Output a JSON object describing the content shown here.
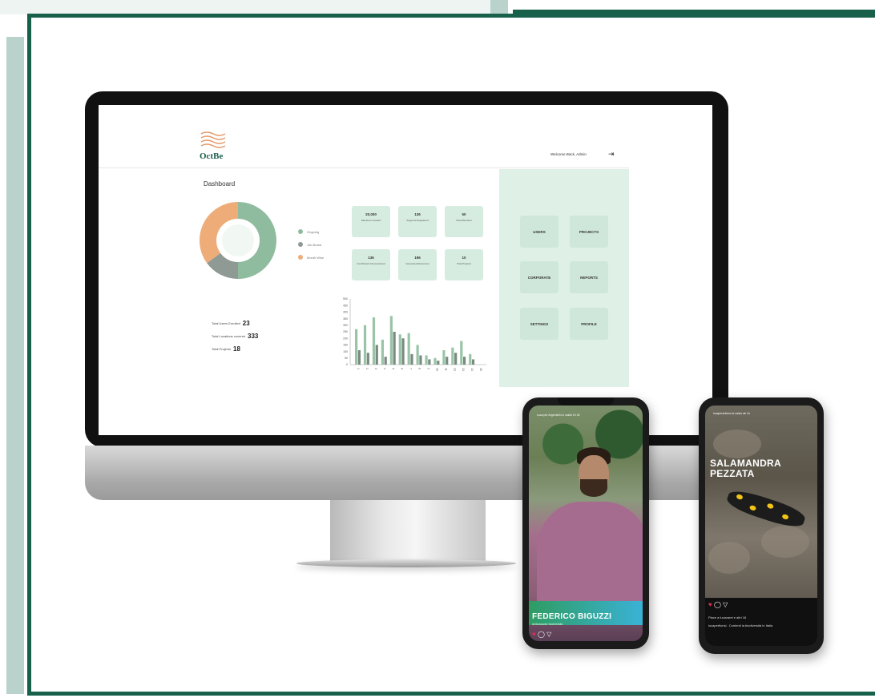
{
  "brand": {
    "logo_text": "OctBe"
  },
  "header": {
    "welcome": "Welcome Back, Admin"
  },
  "dashboard": {
    "title": "Dashboard",
    "legend": [
      {
        "label": "Ongoing",
        "color": "#8fbc9e"
      },
      {
        "label": "Job Board",
        "color": "#8e9a93"
      },
      {
        "label": "Month Wise",
        "color": "#eeac79"
      }
    ],
    "donut_segments": [
      {
        "label": "Ongoing",
        "percent": 50,
        "color": "#8fbc9e"
      },
      {
        "label": "Job Board",
        "percent": 15,
        "color": "#8e9a93"
      },
      {
        "label": "Month Wise",
        "percent": 35,
        "color": "#eeac79"
      }
    ],
    "stats": [
      {
        "value": "20,000",
        "label": "Members Created"
      },
      {
        "value": "136",
        "label": "Supports Registered"
      },
      {
        "value": "50",
        "label": "Total Members"
      },
      {
        "value": "136",
        "label": "Contributors Docs Entered"
      },
      {
        "value": "196",
        "label": "Generated Resources"
      },
      {
        "value": "10",
        "label": "Total Projects"
      }
    ],
    "totals": [
      {
        "label": "Total Users Enrolled",
        "value": "23"
      },
      {
        "label": "Total Locations covered",
        "value": "333"
      },
      {
        "label": "Total Projects",
        "value": "18"
      }
    ],
    "actions": [
      {
        "label": "USERS"
      },
      {
        "label": "PROJECTS"
      },
      {
        "label": "CORPORATE"
      },
      {
        "label": "REPORTS"
      },
      {
        "label": "SETTINGS"
      },
      {
        "label": "PROFILE"
      }
    ]
  },
  "chart_data": {
    "type": "bar",
    "ylim": [
      0,
      500
    ],
    "y_ticks": [
      "500",
      "450",
      "400",
      "350",
      "300",
      "250",
      "200",
      "150",
      "100",
      "50",
      "0"
    ],
    "categories": [
      "1",
      "2",
      "3",
      "4",
      "5",
      "6",
      "7",
      "8",
      "9",
      "10",
      "11",
      "12",
      "13",
      "14",
      "15"
    ],
    "series": [
      {
        "values": [
          270,
          300,
          360,
          190,
          370,
          230,
          240,
          150,
          70,
          50,
          110,
          130,
          180,
          80,
          0
        ]
      },
      {
        "values": [
          110,
          90,
          150,
          60,
          250,
          200,
          80,
          70,
          40,
          30,
          60,
          90,
          60,
          40,
          0
        ]
      }
    ],
    "colors": [
      "#9ac4a6",
      "#7a8a80"
    ]
  },
  "phone1": {
    "top_text": "Luca per ArgentioSi ci calciti 2h 18",
    "name": "FEDERICO BIGUZZI",
    "subtitle": "Ambassador biodiversità"
  },
  "phone2": {
    "top_text": "lucaperarfionsi si calcio ab 1h",
    "title_line1": "SALAMANDRA",
    "title_line2": "PEZZATA",
    "likes": "Piace a lucavaret e altri 18",
    "caption": "lucaperfionsi . Contenti la biodiversità in Italia"
  }
}
